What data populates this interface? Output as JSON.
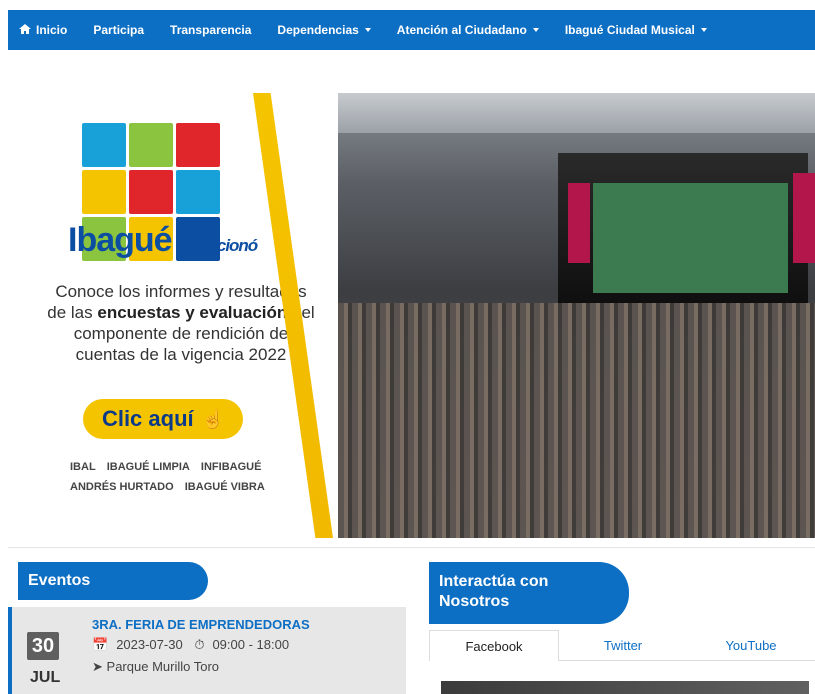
{
  "nav": {
    "items": [
      {
        "label": "Inicio"
      },
      {
        "label": "Participa"
      },
      {
        "label": "Transparencia"
      },
      {
        "label": "Dependencias"
      },
      {
        "label": "Atención al Ciudadano"
      },
      {
        "label": "Ibagué Ciudad Musical"
      }
    ]
  },
  "banner": {
    "brand": "Ibagué",
    "brand_sub": "Evolucionó",
    "text_line1": "Conoce los informes y resultados",
    "text_line2a": "de las ",
    "text_line2b": "encuestas y evaluación",
    "text_line2c": " del",
    "text_line3": "componente de rendición de",
    "text_line4": "cuentas de la vigencia 2022",
    "cta": "Clic aquí",
    "logos": [
      "IBAL",
      "IBAGUÉ LIMPIA",
      "INFIBAGUÉ",
      "ANDRÉS HURTADO",
      "IBAGUÉ VIBRA"
    ]
  },
  "events": {
    "title": "Eventos",
    "item": {
      "day": "30",
      "month": "JUL",
      "title": "3RA. FERIA DE EMPRENDEDORAS",
      "date": "2023-07-30",
      "time": "09:00 - 18:00",
      "place": "Parque Murillo Toro"
    }
  },
  "interact": {
    "title_line1": "Interactúa con",
    "title_line2": "Nosotros",
    "tabs": [
      "Facebook",
      "Twitter",
      "YouTube"
    ]
  }
}
